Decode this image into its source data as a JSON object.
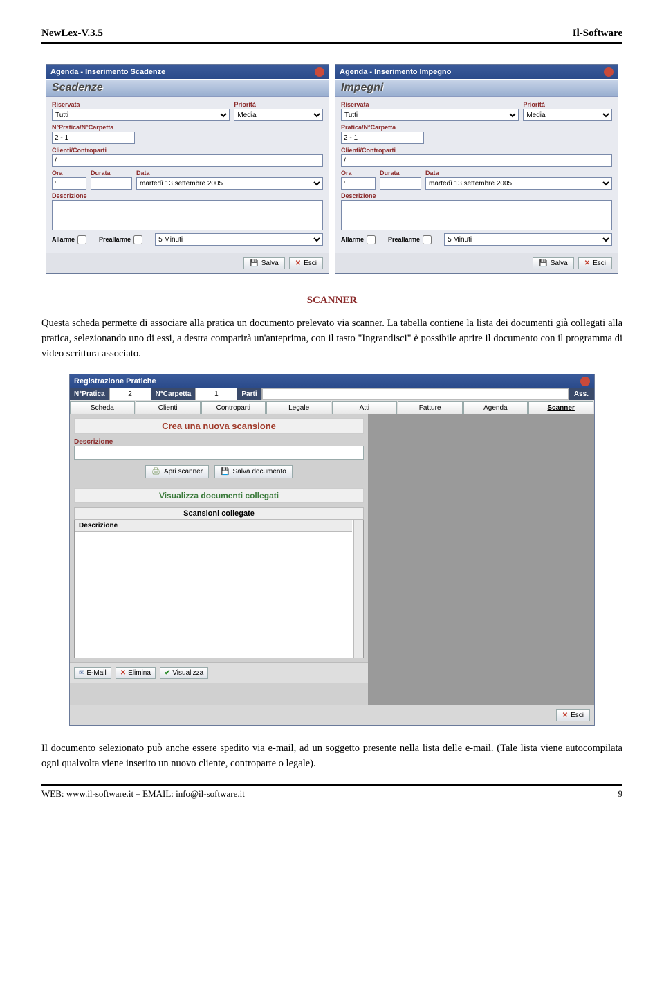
{
  "header": {
    "left": "NewLex-V.3.5",
    "right": "Il-Software"
  },
  "scadenze": {
    "winTitle": "Agenda - Inserimento Scadenze",
    "panel": "Scadenze",
    "riservata_lbl": "Riservata",
    "riservata_val": "Tutti",
    "priorita_lbl": "Priorità",
    "priorita_val": "Media",
    "npratica_lbl": "N°Pratica/N°Carpetta",
    "npratica_val": "2 - 1",
    "clienti_lbl": "Clienti/Controparti",
    "clienti_val": "/",
    "ora_lbl": "Ora",
    "ora_val": ":",
    "durata_lbl": "Durata",
    "durata_val": "",
    "data_lbl": "Data",
    "data_val": "martedì 13 settembre 2005",
    "descr_lbl": "Descrizione",
    "allarme_lbl": "Allarme",
    "preallarme_lbl": "Preallarme",
    "preallarme_val": "5 Minuti",
    "salva": "Salva",
    "esci": "Esci"
  },
  "impegni": {
    "winTitle": "Agenda - Inserimento Impegno",
    "panel": "Impegni",
    "riservata_lbl": "Riservata",
    "riservata_val": "Tutti",
    "priorita_lbl": "Priorità",
    "priorita_val": "Media",
    "npratica_lbl": "Pratica/N°Carpetta",
    "npratica_val": "2 - 1",
    "clienti_lbl": "Clienti/Controparti",
    "clienti_val": "/",
    "ora_lbl": "Ora",
    "ora_val": ":",
    "durata_lbl": "Durata",
    "durata_val": "",
    "data_lbl": "Data",
    "data_val": "martedì 13 settembre 2005",
    "descr_lbl": "Descrizione",
    "allarme_lbl": "Allarme",
    "preallarme_lbl": "Preallarme",
    "preallarme_val": "5 Minuti",
    "salva": "Salva",
    "esci": "Esci"
  },
  "section": {
    "title": "SCANNER",
    "para1": "Questa scheda permette di associare alla pratica un documento prelevato via scanner. La tabella contiene la lista dei documenti già collegati alla pratica, selezionando uno di essi, a destra comparirà un'anteprima, con il tasto \"Ingrandisci\" è possibile aprire il documento con il programma di video scrittura associato.",
    "para2": "Il documento selezionato può anche essere spedito via e-mail, ad un soggetto presente nella lista delle e-mail. (Tale lista viene autocompilata ogni qualvolta viene inserito un nuovo cliente, controparte o legale)."
  },
  "reg": {
    "winTitle": "Registrazione Pratiche",
    "npratica_lbl": "N°Pratica",
    "npratica_val": "2",
    "ncarpetta_lbl": "N°Carpetta",
    "ncarpetta_val": "1",
    "parti_lbl": "Parti",
    "ass_lbl": "Ass.",
    "tabs": [
      "Scheda",
      "Clienti",
      "Controparti",
      "Legale",
      "Atti",
      "Fatture",
      "Agenda",
      "Scanner"
    ],
    "crea": "Crea una nuova scansione",
    "descr_lbl": "Descrizione",
    "apri": "Apri scanner",
    "salvadoc": "Salva documento",
    "visual": "Visualizza documenti collegati",
    "scancol_head": "Scansioni collegate",
    "scancol_col": "Descrizione",
    "email": "E-Mail",
    "elimina": "Elimina",
    "visualizza": "Visualizza",
    "esci": "Esci"
  },
  "footer": {
    "web": "WEB: www.il-software.it – EMAIL: info@il-software.it",
    "page": "9"
  }
}
